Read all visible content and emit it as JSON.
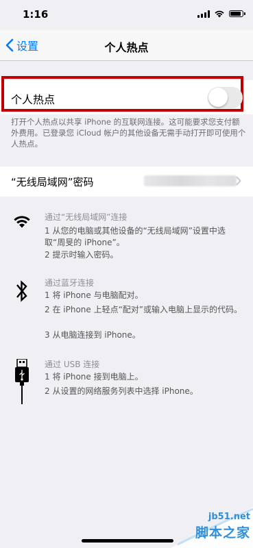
{
  "status_bar": {
    "time": "1:16",
    "icons": [
      "signal-icon",
      "wifi-icon",
      "battery-icon"
    ]
  },
  "nav": {
    "back_label": "设置",
    "title": "个人热点"
  },
  "hotspot": {
    "label": "个人热点",
    "toggle_on": false,
    "description": "打开个人热点以共享 iPhone 的互联网连接。这可能要求您支付额外费用。已登录您 iCloud 帐户的其他设备无需手动打开即可使用个人热点。"
  },
  "password": {
    "label": "“无线局域网”密码"
  },
  "sections": [
    {
      "icon": "wifi-icon",
      "title": "通过“无线局域网”连接",
      "steps": [
        "1 从您的电脑或其他设备的“无线局域网”设置中选取“周旻的 iPhone”。",
        "2 提示时输入密码。"
      ]
    },
    {
      "icon": "bluetooth-icon",
      "title": "通过蓝牙连接",
      "steps": [
        "1 将 iPhone 与电脑配对。",
        "2 在 iPhone 上轻点“配对”或输入电脑上显示的代码。",
        "3 从电脑连接到 iPhone。"
      ]
    },
    {
      "icon": "usb-cable-icon",
      "title": "通过 USB 连接",
      "steps": [
        "1 将 iPhone 接到电脑上。",
        "2 从设置的网络服务列表中选择 iPhone。"
      ]
    }
  ],
  "watermark": {
    "site": "jb51.net",
    "name": "脚本之家"
  },
  "colors": {
    "accent": "#007aff",
    "highlight": "#c00000",
    "background": "#efeff4"
  }
}
